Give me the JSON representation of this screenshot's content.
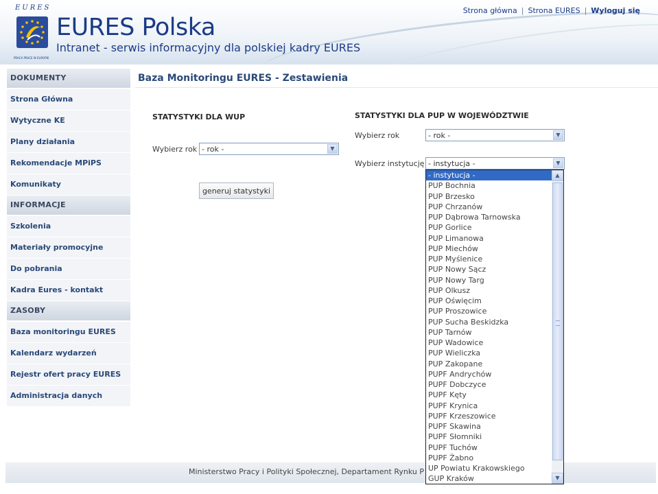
{
  "header": {
    "logo_top": "EURES",
    "logo_small": "PRACA PRACE W EUROPIE",
    "brand": "EURES Polska",
    "subtitle": "Intranet - serwis informacyjny dla polskiej kadry EURES",
    "links": {
      "home": "Strona główna",
      "eures": "Strona EURES",
      "logout": "Wyloguj się"
    }
  },
  "sidebar": {
    "sections": [
      {
        "title": "DOKUMENTY",
        "items": [
          "Strona Główna",
          "Wytyczne KE",
          "Plany działania",
          "Rekomendacje MPiPS",
          "Komunikaty"
        ]
      },
      {
        "title": "INFORMACJE",
        "items": [
          "Szkolenia",
          "Materiały promocyjne",
          "Do pobrania",
          "Kadra Eures - kontakt"
        ]
      },
      {
        "title": "ZASOBY",
        "items": [
          "Baza monitoringu EURES",
          "Kalendarz wydarzeń",
          "Rejestr ofert pracy EURES",
          "Administracja danych"
        ]
      }
    ]
  },
  "main": {
    "title": "Baza Monitoringu EURES - Zestawienia",
    "wup": {
      "heading": "STATYSTYKI DLA WUP",
      "year_label": "Wybierz rok",
      "year_value": "- rok -",
      "generate_button": "generuj statystyki"
    },
    "pup": {
      "heading": "STATYSTYKI DLA PUP W WOJEWÓDZTWIE",
      "year_label": "Wybierz rok",
      "year_value": "- rok -",
      "institution_label": "Wybierz instytucję",
      "institution_value": "- instytucja -",
      "options": [
        "- instytucja -",
        "PUP Bochnia",
        "PUP Brzesko",
        "PUP Chrzanów",
        "PUP Dąbrowa Tarnowska",
        "PUP Gorlice",
        "PUP Limanowa",
        "PUP Miechów",
        "PUP Myślenice",
        "PUP Nowy Sącz",
        "PUP Nowy Targ",
        "PUP Olkusz",
        "PUP Oświęcim",
        "PUP Proszowice",
        "PUP Sucha Beskidzka",
        "PUP Tarnów",
        "PUP Wadowice",
        "PUP Wieliczka",
        "PUP Zakopane",
        "PUPF Andrychów",
        "PUPF Dobczyce",
        "PUPF Kęty",
        "PUPF Krynica",
        "PUPF Krzeszowice",
        "PUPF Skawina",
        "PUPF Słomniki",
        "PUPF Tuchów",
        "PUPF Żabno",
        "UP Powiatu Krakowskiego",
        "GUP Kraków"
      ],
      "selected_index": 0
    }
  },
  "footer": {
    "text": "Ministerstwo Pracy i Polityki Społecznej, Departament Rynku P"
  }
}
